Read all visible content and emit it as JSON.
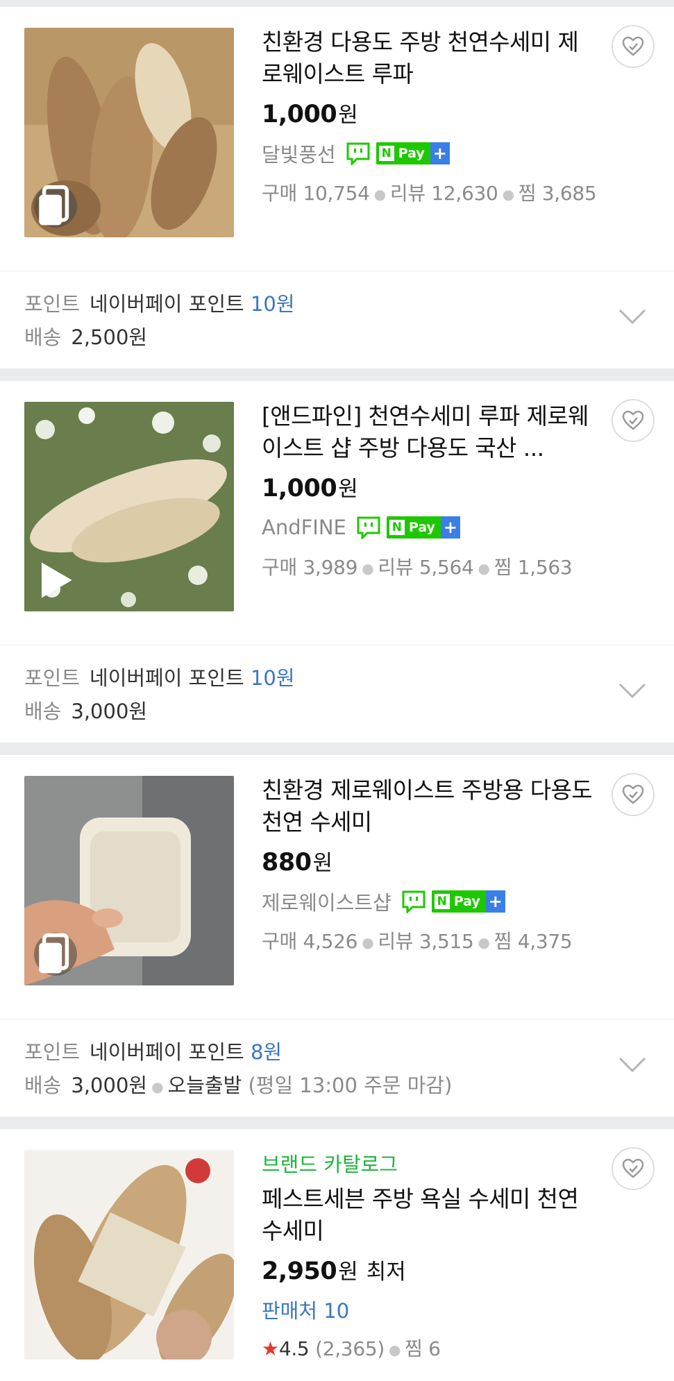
{
  "products": [
    {
      "title": "친환경 다용도 주방 천연수세미 제로웨이스트 루파",
      "price": "1,000",
      "won": "원",
      "seller": "달빛풍선",
      "stats": {
        "purchase": "구매 10,754",
        "review": "리뷰 12,630",
        "wish": "찜 3,685"
      },
      "point_label": "포인트",
      "point_text": "네이버페이 포인트",
      "point_value": "10원",
      "ship_label": "배송",
      "ship_value": "2,500원"
    },
    {
      "title": "[앤드파인] 천연수세미 루파 제로웨이스트 샵 주방 다용도 국산 ...",
      "price": "1,000",
      "won": "원",
      "seller": "AndFINE",
      "stats": {
        "purchase": "구매 3,989",
        "review": "리뷰 5,564",
        "wish": "찜 1,563"
      },
      "point_label": "포인트",
      "point_text": "네이버페이 포인트",
      "point_value": "10원",
      "ship_label": "배송",
      "ship_value": "3,000원"
    },
    {
      "title": "친환경 제로웨이스트 주방용 다용도 천연 수세미",
      "price": "880",
      "won": "원",
      "seller": "제로웨이스트샵",
      "stats": {
        "purchase": "구매 4,526",
        "review": "리뷰 3,515",
        "wish": "찜 4,375"
      },
      "point_label": "포인트",
      "point_text": "네이버페이 포인트",
      "point_value": "8원",
      "ship_label": "배송",
      "ship_value": "3,000원",
      "ship_extra": "오늘출발",
      "ship_note": "(평일 13:00 주문 마감)"
    },
    {
      "brand_category": "브랜드 카탈로그",
      "title": "페스트세븐 주방 욕실 수세미 천연수세미",
      "price": "2,950",
      "won": "원",
      "lowest": "최저",
      "seller_count": "판매처 10",
      "rating": "4.5",
      "rating_count": "(2,365)",
      "wish": "찜 6"
    }
  ],
  "npay": {
    "n": "N",
    "pay": "Pay",
    "plus": "+"
  },
  "icons": {
    "heart": "heart-outline-icon",
    "talk": "talktalk-chat-icon",
    "chevron": "chevron-down-icon",
    "play": "play-icon",
    "photo": "photo-review-icon",
    "star": "star-icon"
  },
  "colors": {
    "brand_green": "#1ec800",
    "link_blue": "#3b76c2",
    "category_green": "#1fb53b",
    "star_red": "#e8372c",
    "separator": "#e9ebee"
  }
}
